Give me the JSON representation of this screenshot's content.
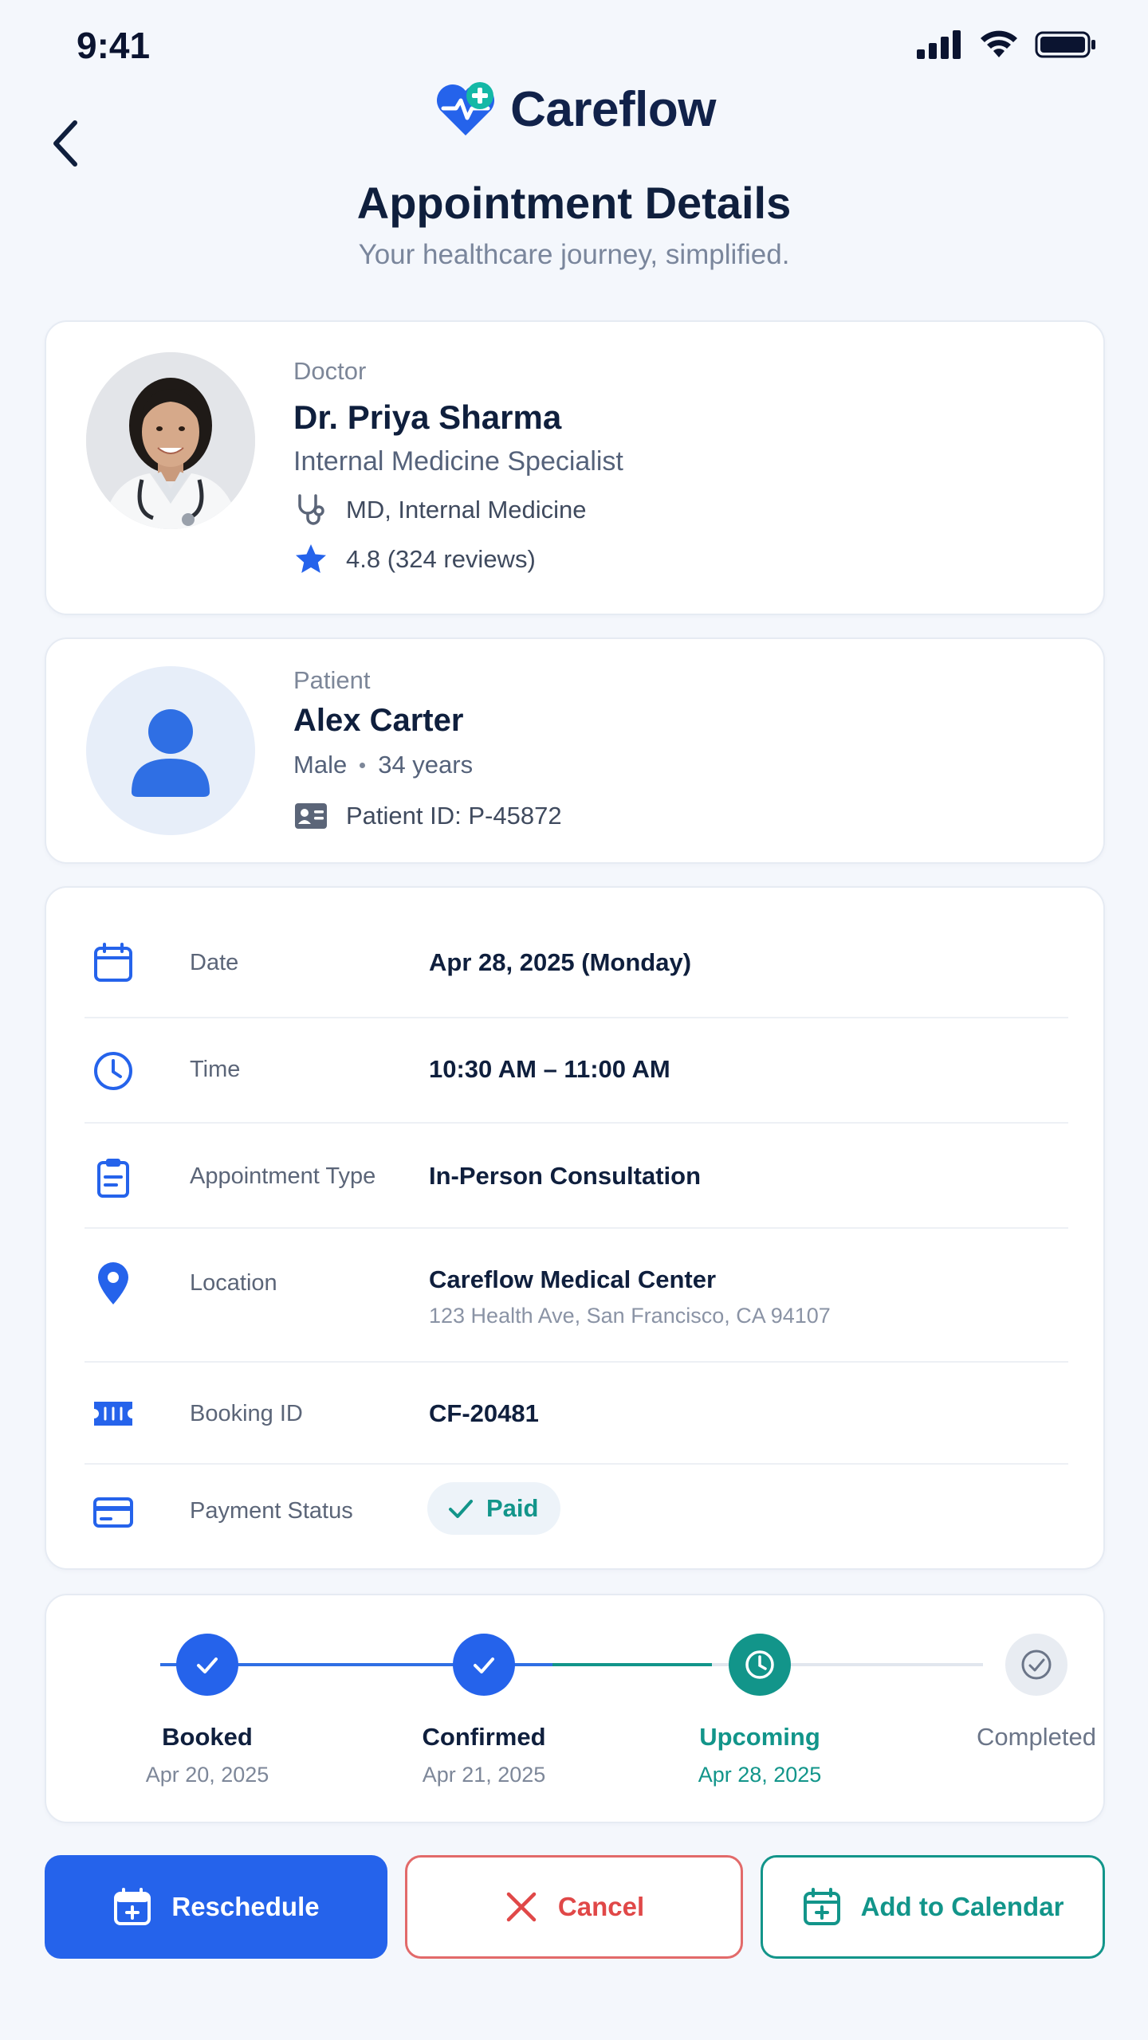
{
  "status_bar": {
    "time": "9:41"
  },
  "header": {
    "brand": "Careflow",
    "title": "Appointment Details",
    "subtitle": "Your healthcare journey, simplified."
  },
  "doctor": {
    "label": "Doctor",
    "name": "Dr. Priya Sharma",
    "specialty": "Internal Medicine Specialist",
    "credentials": "MD, Internal Medicine",
    "rating": "4.8 (324 reviews)"
  },
  "patient": {
    "label": "Patient",
    "name": "Alex Carter",
    "gender": "Male",
    "age": "34 years",
    "patient_id": "Patient ID: P-45872"
  },
  "details": {
    "date_label": "Date",
    "date_value": "Apr 28, 2025 (Monday)",
    "time_label": "Time",
    "time_value": "10:30 AM – 11:00 AM",
    "type_label": "Appointment Type",
    "type_value": "In-Person Consultation",
    "location_label": "Location",
    "location_value": "Careflow Medical Center",
    "location_address": "123 Health Ave, San Francisco, CA 94107",
    "booking_label": "Booking ID",
    "booking_value": "CF-20481",
    "payment_label": "Payment Status",
    "payment_value": "Paid"
  },
  "progress": {
    "steps": [
      {
        "name": "Booked",
        "date": "Apr 20, 2025",
        "state": "done"
      },
      {
        "name": "Confirmed",
        "date": "Apr 21, 2025",
        "state": "done"
      },
      {
        "name": "Upcoming",
        "date": "Apr 28, 2025",
        "state": "current"
      },
      {
        "name": "Completed",
        "date": "",
        "state": "pending"
      }
    ]
  },
  "actions": {
    "reschedule": "Reschedule",
    "cancel": "Cancel",
    "add_calendar": "Add to Calendar"
  },
  "colors": {
    "primary": "#2563eb",
    "teal": "#12958a",
    "danger": "#e04848",
    "navy": "#0f1f3d"
  }
}
